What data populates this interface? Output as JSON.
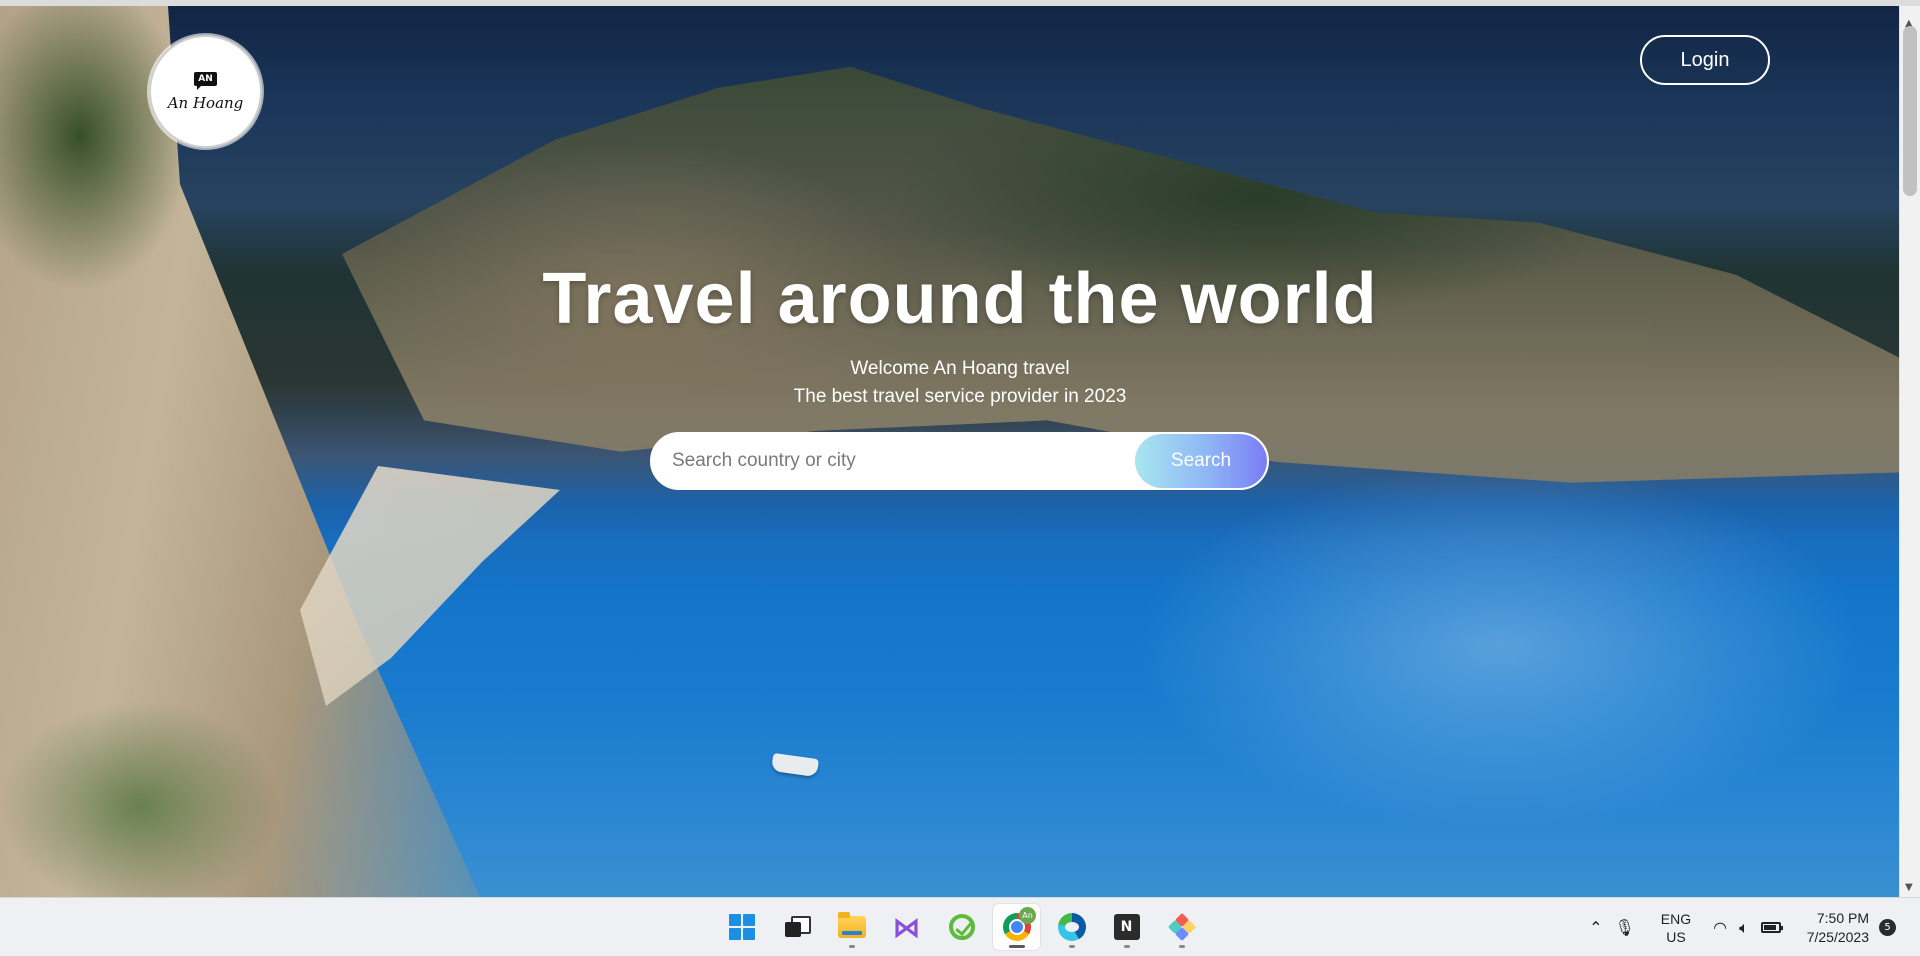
{
  "site": {
    "logo": {
      "badge": "AN",
      "text": "An Hoang"
    },
    "login_label": "Login",
    "headline": "Travel around the world",
    "welcome": "Welcome An Hoang travel",
    "tagline": "The best travel service provider in 2023",
    "search": {
      "placeholder": "Search country or city",
      "value": "",
      "button_label": "Search"
    }
  },
  "taskbar": {
    "apps": [
      {
        "name": "start",
        "icon": "windows-icon"
      },
      {
        "name": "task-view",
        "icon": "task-view-icon"
      },
      {
        "name": "file-explorer",
        "icon": "folder-icon"
      },
      {
        "name": "visual-studio",
        "icon": "visual-studio-icon"
      },
      {
        "name": "green-app",
        "icon": "green-app-icon"
      },
      {
        "name": "chrome",
        "icon": "chrome-icon",
        "active": true,
        "profile_badge": "An"
      },
      {
        "name": "edge",
        "icon": "edge-icon"
      },
      {
        "name": "notion",
        "icon": "notion-icon",
        "label": "N"
      },
      {
        "name": "git-app",
        "icon": "diamond-app-icon"
      }
    ],
    "tray": {
      "lang_line1": "ENG",
      "lang_line2": "US",
      "time": "7:50 PM",
      "date": "7/25/2023",
      "notification_count": "5"
    }
  },
  "colors": {
    "search_button_gradient": [
      "#a8e6f0",
      "#7a7cf5"
    ],
    "windows_blue": "#1a8fe3"
  }
}
